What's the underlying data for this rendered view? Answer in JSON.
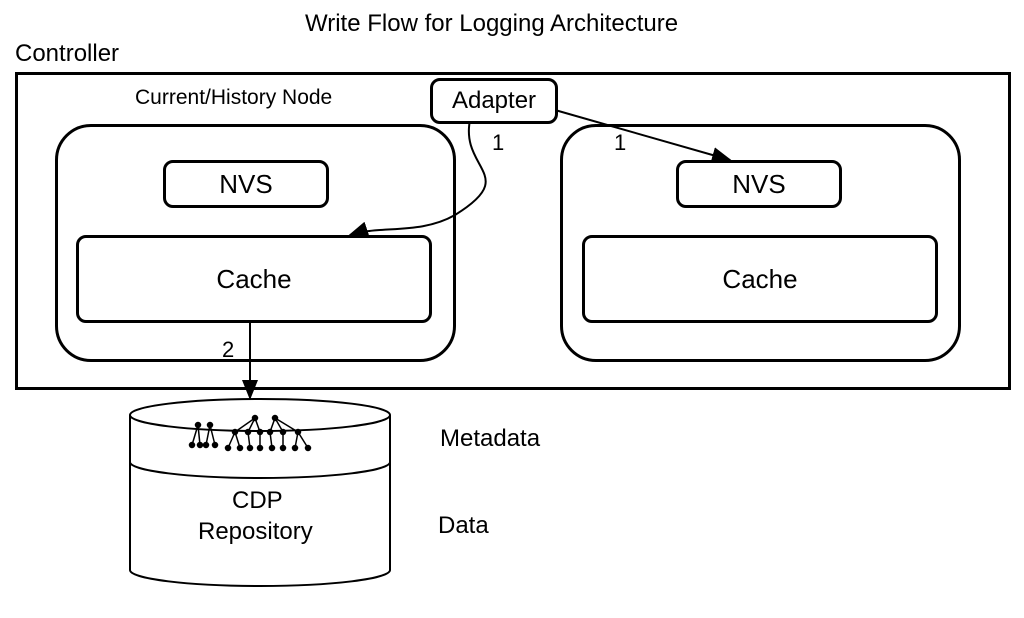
{
  "title": "Write Flow for Logging Architecture",
  "controller_label": "Controller",
  "node_label": "Current/History Node",
  "adapter_label": "Adapter",
  "nvs_label": "NVS",
  "cache_label": "Cache",
  "flow_label_1": "1",
  "flow_label_2": "2",
  "metadata_label": "Metadata",
  "data_label": "Data",
  "repository_line1": "CDP",
  "repository_line2": "Repository",
  "diagram": {
    "type": "architecture-flow",
    "components": [
      {
        "id": "controller",
        "label": "Controller",
        "contains": [
          "adapter",
          "node_left",
          "node_right"
        ]
      },
      {
        "id": "adapter",
        "label": "Adapter"
      },
      {
        "id": "node_left",
        "label": "Current/History Node",
        "contains": [
          "nvs_left",
          "cache_left"
        ]
      },
      {
        "id": "node_right",
        "contains": [
          "nvs_right",
          "cache_right"
        ]
      },
      {
        "id": "nvs_left",
        "label": "NVS"
      },
      {
        "id": "nvs_right",
        "label": "NVS"
      },
      {
        "id": "cache_left",
        "label": "Cache"
      },
      {
        "id": "cache_right",
        "label": "Cache"
      },
      {
        "id": "cdp_repository",
        "label": "CDP Repository",
        "sections": [
          "Metadata",
          "Data"
        ]
      }
    ],
    "flows": [
      {
        "from": "adapter",
        "to": "cache_left",
        "label": "1"
      },
      {
        "from": "adapter",
        "to": "nvs_right",
        "label": "1"
      },
      {
        "from": "cache_left",
        "to": "cdp_repository",
        "label": "2"
      }
    ]
  }
}
